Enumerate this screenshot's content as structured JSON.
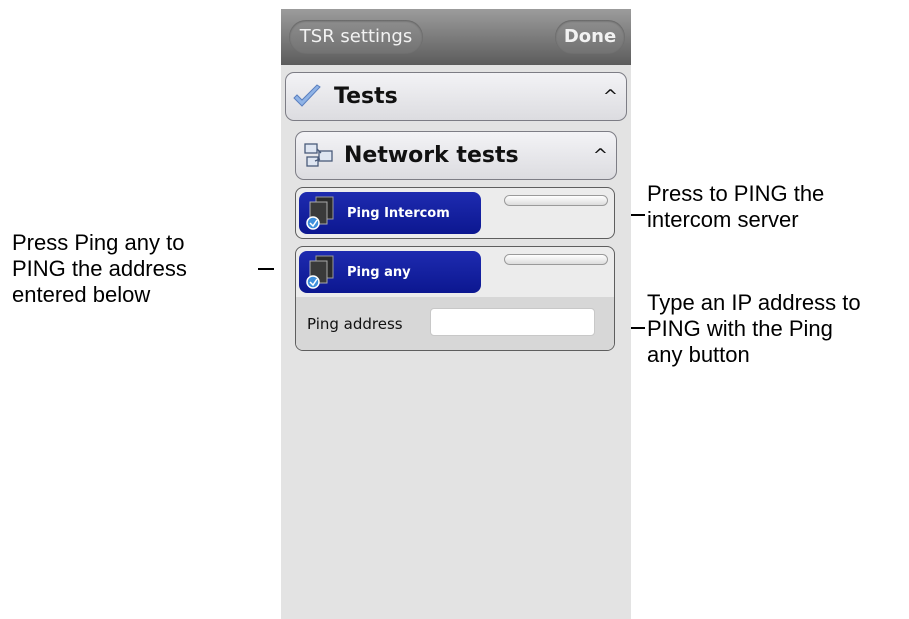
{
  "callouts": {
    "left": "Press Ping any to\nPING the address\nentered below",
    "right_top": "Press to PING the\nintercom server",
    "right_bottom": "Type an IP address to\nPING with the Ping\nany button"
  },
  "topbar": {
    "back_label": "TSR settings",
    "done_label": "Done"
  },
  "sections": {
    "tests": {
      "label": "Tests",
      "chevron": "^",
      "icon": "checkmark-icon"
    },
    "network_tests": {
      "label": "Network tests",
      "chevron": "^",
      "icon": "network-icon"
    }
  },
  "ping_intercom": {
    "label": "Ping Intercom",
    "progress": 0,
    "icon": "network-computers-icon"
  },
  "ping_any": {
    "label": "Ping any",
    "progress": 0,
    "icon": "network-computers-icon"
  },
  "ping_address": {
    "label": "Ping address",
    "value": "",
    "placeholder": ""
  },
  "colors": {
    "ping_button": "#0c1790",
    "topbar": "#6a6a6a",
    "background": "#e3e3e3"
  }
}
